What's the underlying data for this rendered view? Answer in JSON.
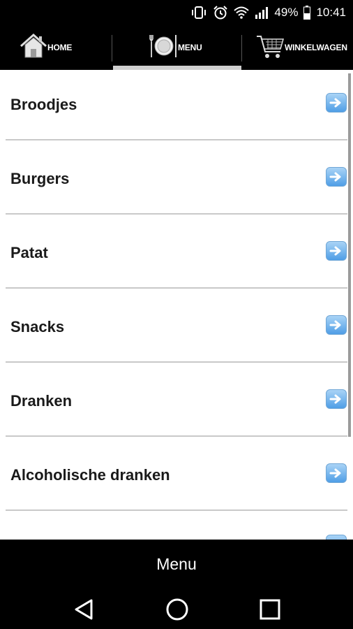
{
  "status_bar": {
    "battery_percent": "49%",
    "time": "10:41",
    "icons": [
      "vibrate-icon",
      "alarm-icon",
      "wifi-icon",
      "signal-icon",
      "battery-icon"
    ]
  },
  "topnav": {
    "tabs": [
      {
        "label": "HOME",
        "icon": "home-icon"
      },
      {
        "label": "MENU",
        "icon": "plate-icon",
        "active": true
      },
      {
        "label": "WINKELWAGEN",
        "icon": "cart-icon"
      }
    ]
  },
  "menu": {
    "items": [
      {
        "label": "Broodjes"
      },
      {
        "label": "Burgers"
      },
      {
        "label": "Patat"
      },
      {
        "label": "Snacks"
      },
      {
        "label": "Dranken"
      },
      {
        "label": "Alcoholische dranken"
      },
      {
        "label": ""
      }
    ]
  },
  "bottom_bar": {
    "title": "Menu"
  },
  "android_nav": {
    "buttons": [
      "back-icon",
      "home-circle-icon",
      "recents-icon"
    ]
  },
  "colors": {
    "arrow_top": "#a9d3f6",
    "arrow_bottom": "#4f9ee6",
    "bar": "#000000",
    "separator": "#c9c9c9"
  }
}
